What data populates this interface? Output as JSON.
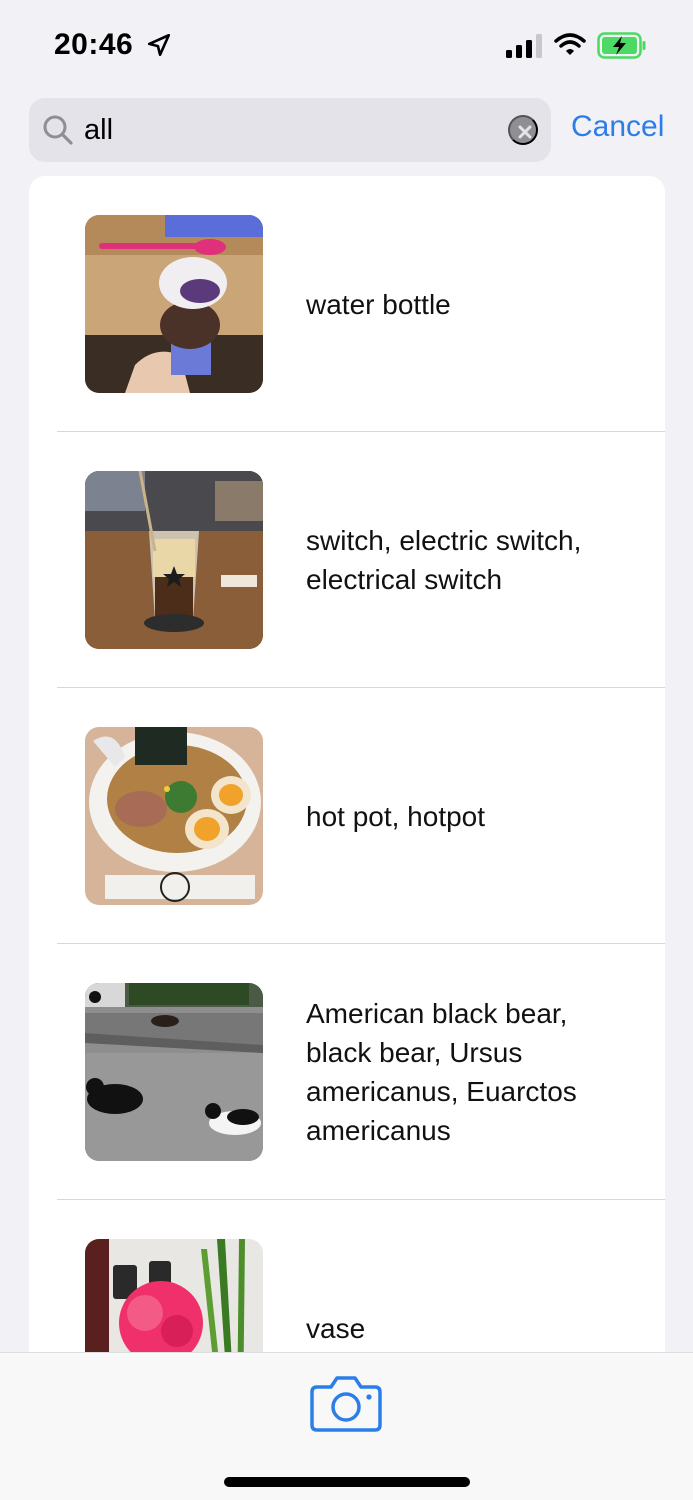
{
  "status_bar": {
    "time": "20:46",
    "icons": [
      "location-arrow-icon",
      "cellular-signal-icon",
      "wifi-icon",
      "battery-charging-icon"
    ]
  },
  "search": {
    "value": "all",
    "cancel_label": "Cancel"
  },
  "results": [
    {
      "label": "water bottle",
      "thumb": "ice-cream-cone-photo"
    },
    {
      "label": "switch, electric switch, electrical switch",
      "thumb": "iced-drink-photo"
    },
    {
      "label": "hot pot, hotpot",
      "thumb": "ramen-bowl-photo"
    },
    {
      "label": "American black bear, black bear, Ursus americanus, Euarctos americanus",
      "thumb": "cats-on-pavement-photo"
    },
    {
      "label": "vase",
      "thumb": "pink-flower-photo"
    }
  ],
  "colors": {
    "accent": "#2b7de9",
    "background": "#f1f1f6",
    "battery": "#4cd964"
  },
  "bottom_bar": {
    "icon": "camera-icon"
  }
}
